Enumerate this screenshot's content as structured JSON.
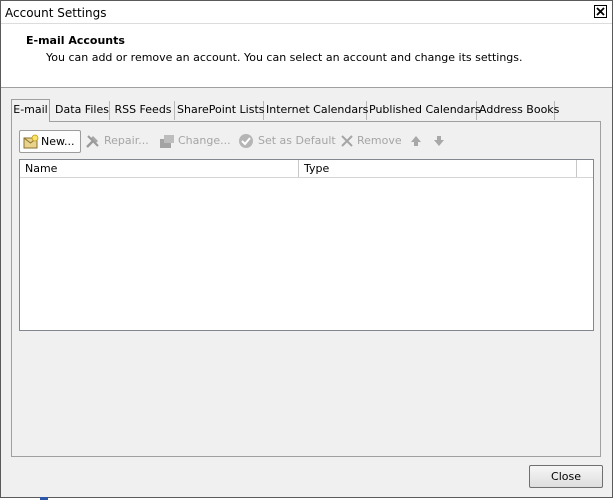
{
  "window": {
    "title": "Account Settings"
  },
  "header": {
    "title": "E-mail Accounts",
    "subtitle": "You can add or remove an account. You can select an account and change its settings."
  },
  "tabs": [
    {
      "label": "E-mail",
      "active": true
    },
    {
      "label": "Data Files",
      "active": false
    },
    {
      "label": "RSS Feeds",
      "active": false
    },
    {
      "label": "SharePoint Lists",
      "active": false
    },
    {
      "label": "Internet Calendars",
      "active": false
    },
    {
      "label": "Published Calendars",
      "active": false
    },
    {
      "label": "Address Books",
      "active": false
    }
  ],
  "toolbar": {
    "new_label": "New...",
    "repair_label": "Repair...",
    "change_label": "Change...",
    "set_default_label": "Set as Default",
    "remove_label": "Remove"
  },
  "list": {
    "columns": [
      "Name",
      "Type"
    ],
    "rows": []
  },
  "footer": {
    "close_label": "Close"
  }
}
